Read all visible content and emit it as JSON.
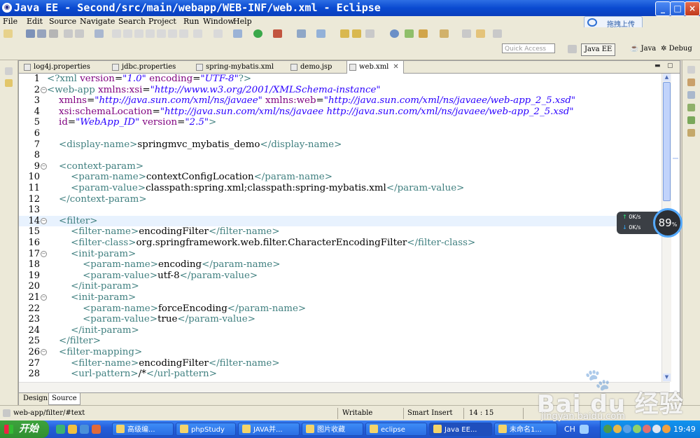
{
  "window": {
    "title": "Java EE - Second/src/main/webapp/WEB-INF/web.xml - Eclipse",
    "minimize": "_",
    "maximize": "□",
    "close": "×"
  },
  "menu": [
    "File",
    "Edit",
    "Source",
    "Navigate",
    "Search",
    "Project",
    "Run",
    "Window",
    "Help"
  ],
  "baidu_button": {
    "label": "拖拽上传",
    "icon": "cloud-icon"
  },
  "toolbar": {
    "quick_access_placeholder": "Quick Access",
    "perspectives": [
      "Java EE",
      "Java",
      "Debug"
    ]
  },
  "editor_tabs": [
    {
      "label": "log4j.properties",
      "active": false
    },
    {
      "label": "jdbc.properties",
      "active": false
    },
    {
      "label": "spring-mybatis.xml",
      "active": false
    },
    {
      "label": "demo.jsp",
      "active": false
    },
    {
      "label": "web.xml",
      "active": true,
      "close": "✕"
    }
  ],
  "code": {
    "highlighted_line": 14,
    "lines": [
      {
        "n": "1",
        "fold": false,
        "text": "<?xml version=\"1.0\" encoding=\"UTF-8\"?>"
      },
      {
        "n": "2",
        "fold": true,
        "text": "<web-app xmlns:xsi=\"http://www.w3.org/2001/XMLSchema-instance\""
      },
      {
        "n": "3",
        "fold": false,
        "text": "    xmlns=\"http://java.sun.com/xml/ns/javaee\" xmlns:web=\"http://java.sun.com/xml/ns/javaee/web-app_2_5.xsd\""
      },
      {
        "n": "4",
        "fold": false,
        "text": "    xsi:schemaLocation=\"http://java.sun.com/xml/ns/javaee http://java.sun.com/xml/ns/javaee/web-app_2_5.xsd\""
      },
      {
        "n": "5",
        "fold": false,
        "text": "    id=\"WebApp_ID\" version=\"2.5\">"
      },
      {
        "n": "6",
        "fold": false,
        "text": ""
      },
      {
        "n": "7",
        "fold": false,
        "text": "    <display-name>springmvc_mybatis_demo</display-name>"
      },
      {
        "n": "8",
        "fold": false,
        "text": ""
      },
      {
        "n": "9",
        "fold": true,
        "text": "    <context-param>"
      },
      {
        "n": "10",
        "fold": false,
        "text": "        <param-name>contextConfigLocation</param-name>"
      },
      {
        "n": "11",
        "fold": false,
        "text": "        <param-value>classpath:spring.xml;classpath:spring-mybatis.xml</param-value>"
      },
      {
        "n": "12",
        "fold": false,
        "text": "    </context-param>"
      },
      {
        "n": "13",
        "fold": false,
        "text": ""
      },
      {
        "n": "14",
        "fold": true,
        "text": "    <filter>"
      },
      {
        "n": "15",
        "fold": false,
        "text": "        <filter-name>encodingFilter</filter-name>"
      },
      {
        "n": "16",
        "fold": false,
        "text": "        <filter-class>org.springframework.web.filter.CharacterEncodingFilter</filter-class>"
      },
      {
        "n": "17",
        "fold": true,
        "text": "        <init-param>"
      },
      {
        "n": "18",
        "fold": false,
        "text": "            <param-name>encoding</param-name>"
      },
      {
        "n": "19",
        "fold": false,
        "text": "            <param-value>utf-8</param-value>"
      },
      {
        "n": "20",
        "fold": false,
        "text": "        </init-param>"
      },
      {
        "n": "21",
        "fold": true,
        "text": "        <init-param>"
      },
      {
        "n": "22",
        "fold": false,
        "text": "            <param-name>forceEncoding</param-name>"
      },
      {
        "n": "23",
        "fold": false,
        "text": "            <param-value>true</param-value>"
      },
      {
        "n": "24",
        "fold": false,
        "text": "        </init-param>"
      },
      {
        "n": "25",
        "fold": false,
        "text": "    </filter>"
      },
      {
        "n": "26",
        "fold": true,
        "text": "    <filter-mapping>"
      },
      {
        "n": "27",
        "fold": false,
        "text": "        <filter-name>encodingFilter</filter-name>"
      },
      {
        "n": "28",
        "fold": false,
        "text": "        <url-pattern>/*</url-pattern>"
      }
    ]
  },
  "editor_bottom_tabs": [
    {
      "label": "Design",
      "active": false
    },
    {
      "label": "Source",
      "active": true
    }
  ],
  "speed_widget": {
    "up": "0K/s",
    "down": "0K/s",
    "percent": "89",
    "percent_unit": "%"
  },
  "status": {
    "path": "web-app/filter/#text",
    "writable": "Writable",
    "insert_mode": "Smart Insert",
    "position": "14 : 15"
  },
  "taskbar": {
    "start": "开始",
    "tasks": [
      {
        "label": "高级编...",
        "active": false
      },
      {
        "label": "phpStudy",
        "active": false
      },
      {
        "label": "JAVA并...",
        "active": false
      },
      {
        "label": "图片收藏",
        "active": false
      },
      {
        "label": "eclipse",
        "active": false
      },
      {
        "label": "Java EE...",
        "active": true
      },
      {
        "label": "未命名1...",
        "active": false
      }
    ],
    "lang": "CH",
    "clock": "19:49"
  },
  "watermark": {
    "brand": "Bai du 经验",
    "url": "jingyan.baidu.com"
  },
  "colors": {
    "tag": "#3f7f7f",
    "attribute": "#7f007f",
    "attribute_value": "#2a00ff",
    "highlight_line": "#e8f2fe",
    "titlebar": "#0a4ad0"
  }
}
